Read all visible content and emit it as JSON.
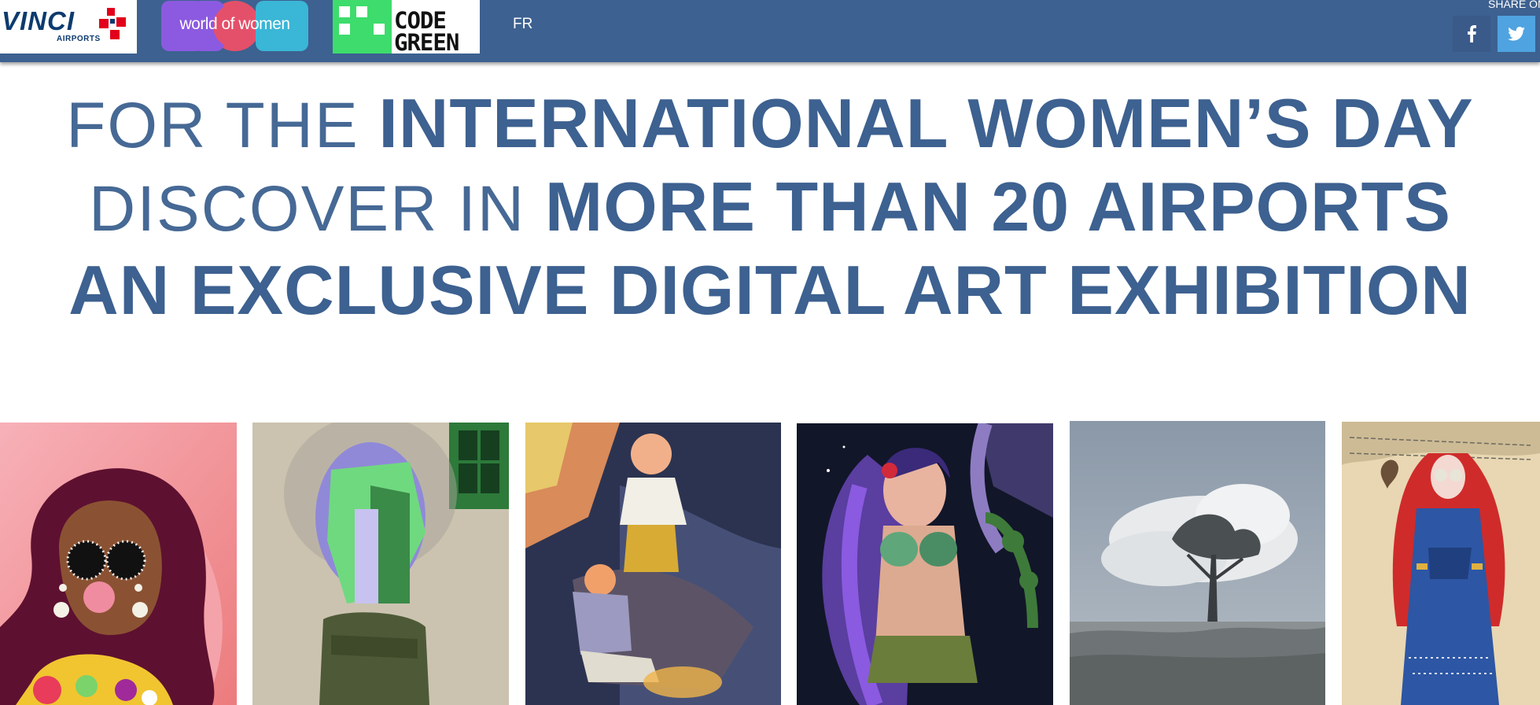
{
  "header": {
    "vinci_logo": {
      "word": "VINCI",
      "sub": "AIRPORTS"
    },
    "wow_logo": {
      "text": "world of women"
    },
    "codegreen_logo": {
      "line1": "CODE",
      "line2": "GREEN"
    },
    "language": "FR",
    "share": {
      "label": "SHARE ON",
      "facebook_icon": "facebook-icon",
      "twitter_icon": "twitter-icon"
    },
    "colors": {
      "bar": "#3d6190",
      "facebook": "#3a5a8a",
      "twitter": "#4fa3e0",
      "code_green": "#3ddc6c"
    }
  },
  "headline": {
    "line1_thin": "FOR THE ",
    "line1_bold": "INTERNATIONAL WOMEN’S DAY",
    "line2_thin": "DISCOVER IN ",
    "line2_bold": "MORE THAN 20 AIRPORTS",
    "line3_bold": "AN EXCLUSIVE DIGITAL ART EXHIBITION",
    "color": "#3d6190"
  },
  "gallery": {
    "artworks": [
      {
        "subject": "woman with sunglasses blowing bubblegum"
      },
      {
        "subject": "green sculpted head on tree stump"
      },
      {
        "subject": "two figures with dark creature illustration"
      },
      {
        "subject": "purple haired woman with leaves"
      },
      {
        "subject": "lone tree in grey field"
      },
      {
        "subject": "woman in red veil and blue dress"
      }
    ]
  }
}
